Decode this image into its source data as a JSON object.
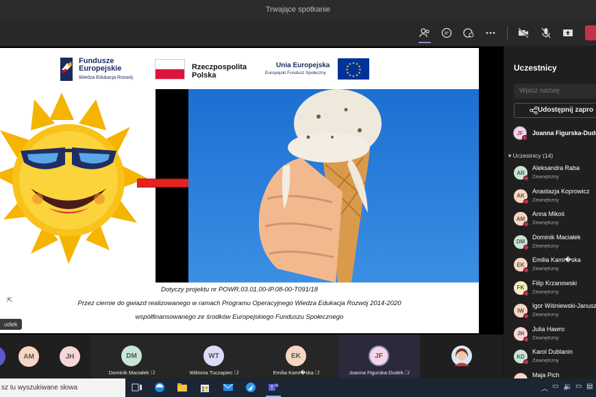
{
  "window": {
    "title": "Trwające spotkanie"
  },
  "slide": {
    "logo1_line1": "Fundusze",
    "logo1_line2": "Europejskie",
    "logo1_sub": "Wiedza Edukacja Rozwój",
    "logo2_line1": "Rzeczpospolita",
    "logo2_line2": "Polska",
    "logo3_title": "Unia Europejska",
    "logo3_sub": "Europejski Fundusz Społeczny",
    "caption1": "Dotyczy projektu nr POWR.03.01.00-IP.08-00-T091/18",
    "caption2": "Przez ciernie do gwiazd realizowanego w ramach Programu Operacyjnego Wiedza Edukacja Rozwój 2014-2020",
    "caption3": "współfinansowanego ze środków Europejskiego Funduszu Społecznego"
  },
  "stage": {
    "namechip": "udek"
  },
  "panel": {
    "title": "Uczestnicy",
    "search_placeholder": "Wpisz nazwę",
    "share_label": "Udostępnij zapro",
    "presenter": {
      "initials": "JF",
      "name": "Joanna Figurska-Dudek"
    },
    "group_label": "Uczestnicy (14)",
    "participants": [
      {
        "initials": "AR",
        "name": "Aleksandra Raba",
        "sub": "Zewnętrzny",
        "color": "#c9e5d6"
      },
      {
        "initials": "AK",
        "name": "Anastazja Koprowicz",
        "sub": "Zewnętrzny",
        "color": "#f6d6c2"
      },
      {
        "initials": "AM",
        "name": "Anna Mikoś",
        "sub": "Zewnętrzny",
        "color": "#f6d6c2"
      },
      {
        "initials": "DM",
        "name": "Dominik Maciałek",
        "sub": "Zewnętrzny",
        "color": "#c9e5d6"
      },
      {
        "initials": "EK",
        "name": "Emilia Kami�ska",
        "sub": "Zewnętrzny",
        "color": "#f6d6c2"
      },
      {
        "initials": "FK",
        "name": "Filip Krzanowski",
        "sub": "Zewnętrzny",
        "color": "#f6ecc2"
      },
      {
        "initials": "IW",
        "name": "Igor Wiśniewski-Janusz",
        "sub": "Zewnętrzny",
        "color": "#f6d6c2"
      },
      {
        "initials": "JH",
        "name": "Julia Hawro",
        "sub": "Zewnętrzny",
        "color": "#f6d6d6"
      },
      {
        "initials": "KD",
        "name": "Karol Dublanin",
        "sub": "Zewnętrzny",
        "color": "#c9e5d6"
      },
      {
        "initials": "",
        "name": "Maja Pich",
        "sub": "",
        "color": "#f6d6c2"
      }
    ]
  },
  "strip": {
    "tiles": [
      {
        "initials": "AM",
        "label": "",
        "color": "#f6d6c2"
      },
      {
        "initials": "JH",
        "label": "",
        "color": "#f6d6d6"
      },
      {
        "initials": "DM",
        "label": "Dominik Maciałek",
        "color": "#c9e5d6"
      },
      {
        "initials": "WT",
        "label": "Wiktoria Tuczapiec",
        "color": "#dcdcf6"
      },
      {
        "initials": "EK",
        "label": "Emilia Kami�ska",
        "color": "#f6d6c2"
      },
      {
        "initials": "JF",
        "label": "Joanna Figurska-Dudek",
        "color": "#f6d6e6"
      }
    ]
  },
  "taskbar": {
    "search_text": "sz tu wyszukiwane słowa"
  }
}
